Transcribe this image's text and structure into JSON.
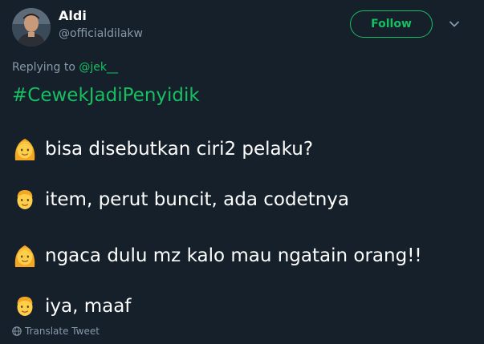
{
  "user": {
    "display_name": "Aldi",
    "handle": "@officialdilakw",
    "avatar_icon": "profile-photo"
  },
  "follow_button": {
    "label": "Follow",
    "color": "#17bf63"
  },
  "menu_icon": "chevron-down-icon",
  "reply": {
    "prefix": "Replying to ",
    "mention": "@jek__"
  },
  "tweet": {
    "hashtag": "#CewekJadiPenyidik",
    "lines": [
      {
        "speaker_icon": "woman-emoji-icon",
        "text": "bisa disebutkan ciri2 pelaku?"
      },
      {
        "speaker_icon": "man-emoji-icon",
        "text": "item, perut buncit, ada codetnya"
      },
      {
        "speaker_icon": "woman-emoji-icon",
        "text": "ngaca dulu mz kalo mau ngatain orang!!"
      },
      {
        "speaker_icon": "man-emoji-icon",
        "text": "iya, maaf"
      }
    ]
  },
  "translate": {
    "label": "Translate Tweet",
    "icon": "globe-icon"
  },
  "colors": {
    "background": "#15202b",
    "accent": "#17bf63",
    "secondary_text": "#8899a6"
  }
}
